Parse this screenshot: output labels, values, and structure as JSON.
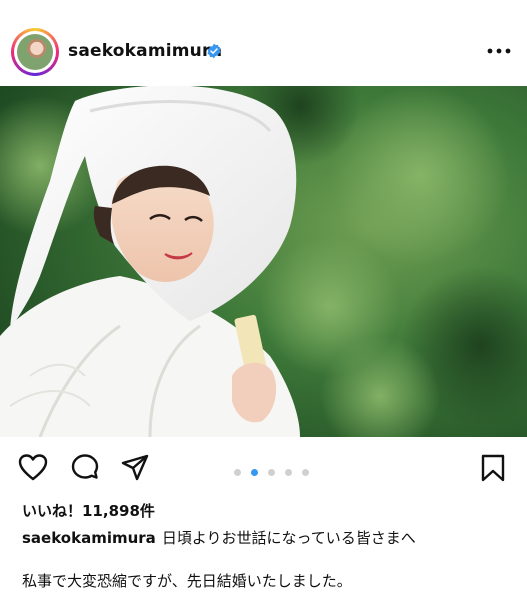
{
  "post": {
    "username": "saekokamimura",
    "verified_icon": "verified-badge-icon",
    "more_icon": "more-options-icon",
    "carousel": {
      "count": 5,
      "active_index": 1
    },
    "likes_text": "いいね！11,898件",
    "caption_user": "saekokamimura",
    "caption_line1": "日頃よりお世話になっている皆さまへ",
    "caption_line2": "私事で大変恐縮ですが、先日結婚いたしました。"
  },
  "actions": {
    "like_icon": "heart-icon",
    "comment_icon": "comment-icon",
    "share_icon": "send-icon",
    "save_icon": "bookmark-icon"
  },
  "colors": {
    "accent_blue": "#3897f0",
    "verified_blue": "#3897f0",
    "foliage": "#3f7a3a",
    "kimono_white": "#f6f6f4"
  }
}
